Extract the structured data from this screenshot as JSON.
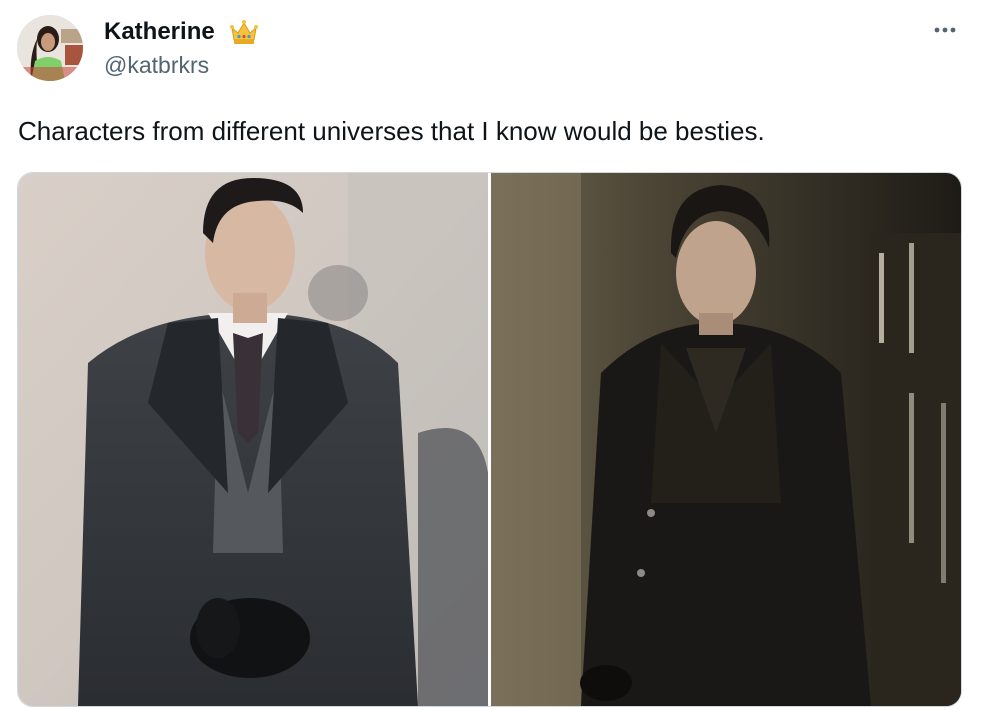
{
  "author": {
    "display_name": "Katherine",
    "handle": "@katbrkrs",
    "badge_icon": "crown-icon"
  },
  "tweet": {
    "text": "Characters from different universes that I know would be besties."
  },
  "media": {
    "count": 2
  },
  "colors": {
    "text_primary": "#0f1419",
    "text_secondary": "#536471",
    "border": "#cfd9de"
  },
  "icons": {
    "more": "more-icon"
  }
}
